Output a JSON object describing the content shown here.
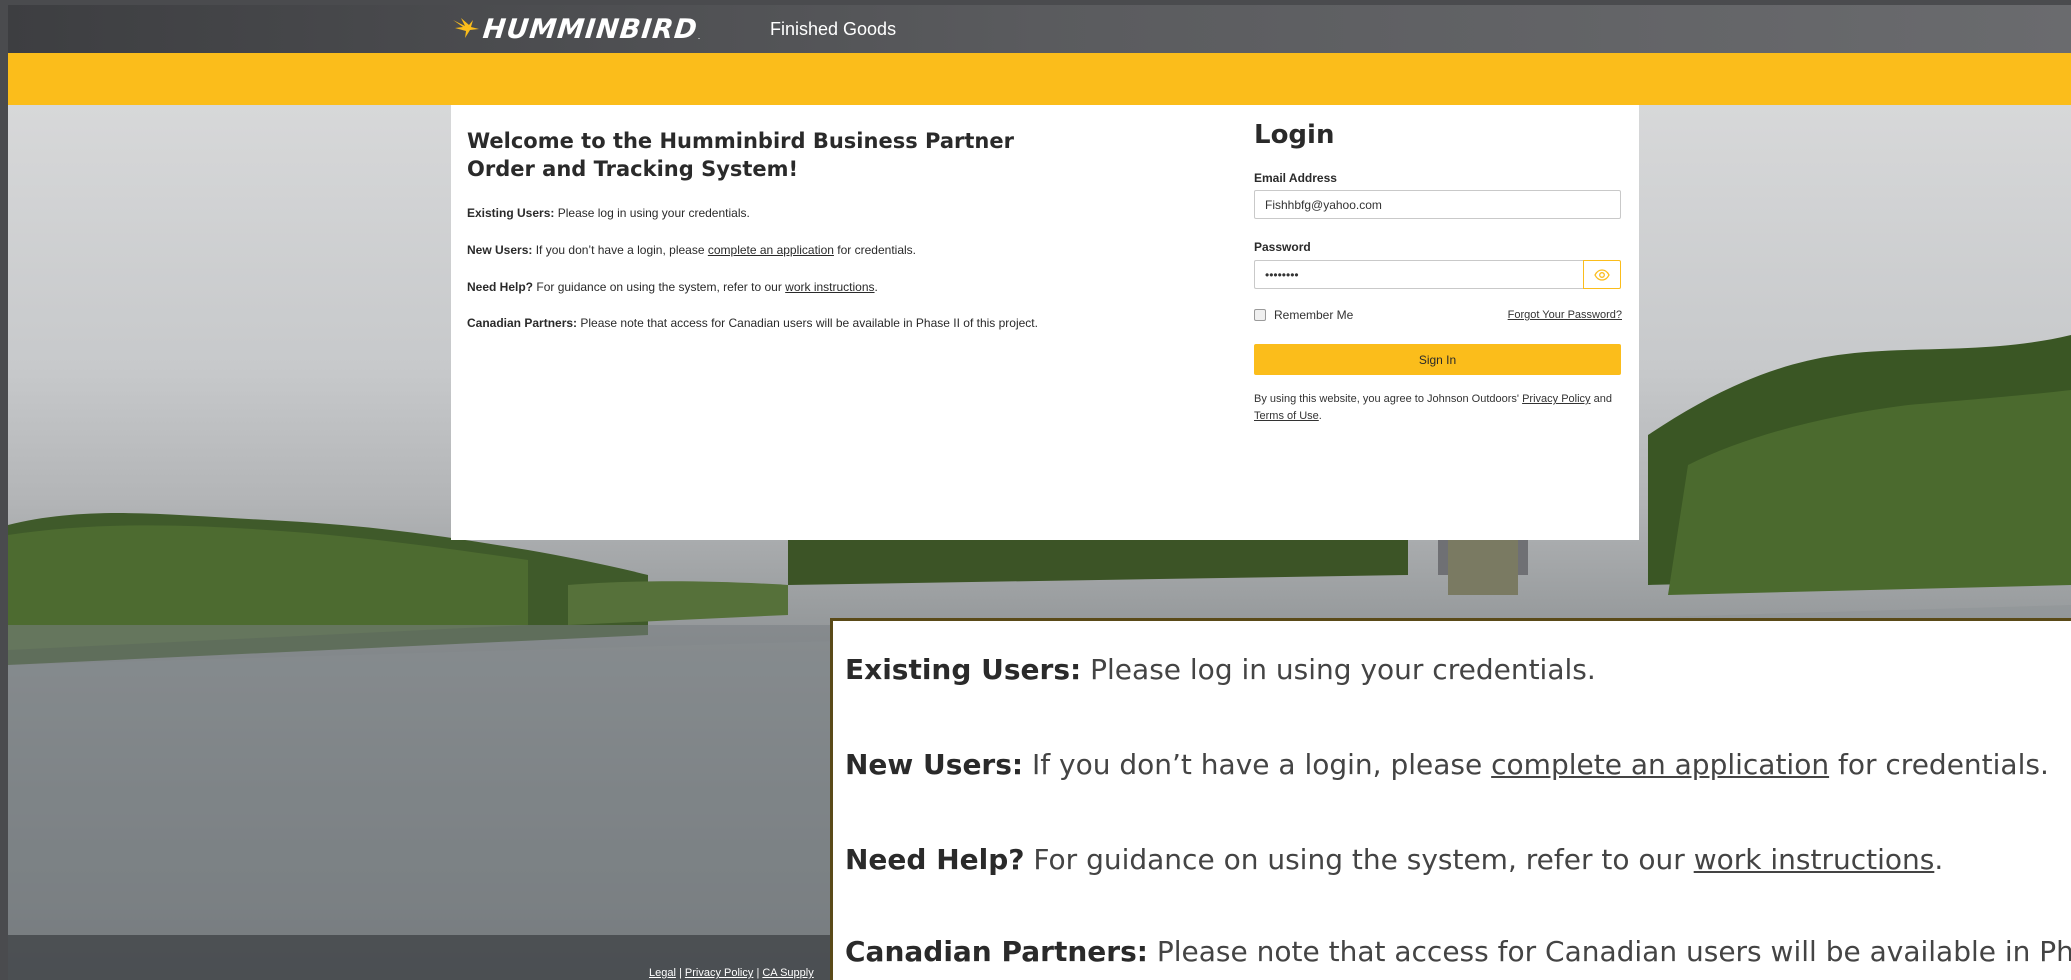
{
  "header": {
    "brand": "HUMMINBIRD",
    "trademark": ".",
    "app_name": "Finished Goods"
  },
  "welcome": {
    "title": "Welcome to the Humminbird Business Partner Order and Tracking System!",
    "existing": {
      "label": "Existing Users:",
      "text": "Please log in using your credentials."
    },
    "new_users": {
      "label": "New Users:",
      "before": "If you don’t have a login, please",
      "link": "complete an application",
      "after": "for credentials."
    },
    "help": {
      "label": "Need Help?",
      "before": "For guidance on using the system, refer to our",
      "link": "work instructions",
      "after": "."
    },
    "canadian": {
      "label": "Canadian Partners:",
      "text": "Please note that access for Canadian users will be available in Phase II of this project."
    }
  },
  "login": {
    "title": "Login",
    "email_label": "Email Address",
    "email_value": "Fishhbfg@yahoo.com",
    "password_label": "Password",
    "password_value": "••••••••",
    "remember_label": "Remember Me",
    "remember_checked": false,
    "forgot_label": "Forgot Your Password?",
    "signin_label": "Sign In",
    "terms_before": "By using this website, you agree to Johnson Outdoors'",
    "privacy_link": "Privacy Policy",
    "terms_and": "and",
    "terms_link": "Terms of Use",
    "terms_after": "."
  },
  "footer": {
    "legal": "Legal",
    "sep": "|",
    "privacy": "Privacy Policy",
    "ca_supply": "CA Supply"
  },
  "zoom": {
    "existing": {
      "label": "Existing Users:",
      "text": "Please log in using your credentials."
    },
    "new_users": {
      "label": "New Users:",
      "before": "If you don’t have a login, please",
      "link": "complete an application",
      "after": "for credentials."
    },
    "help": {
      "label": "Need Help?",
      "before": "For guidance on using the system, refer to our",
      "link": "work instructions",
      "after": "."
    },
    "canadian": {
      "label": "Canadian Partners:",
      "text": "Please note that access for Canadian users will be available in Phase"
    }
  },
  "colors": {
    "accent": "#fbbd1b",
    "topbar": "#4a4b4e",
    "panel": "#ffffff",
    "text": "#2a2a2a"
  },
  "icons": {
    "logo": "hummingbird-logo-icon",
    "password_toggle": "eye-icon"
  }
}
